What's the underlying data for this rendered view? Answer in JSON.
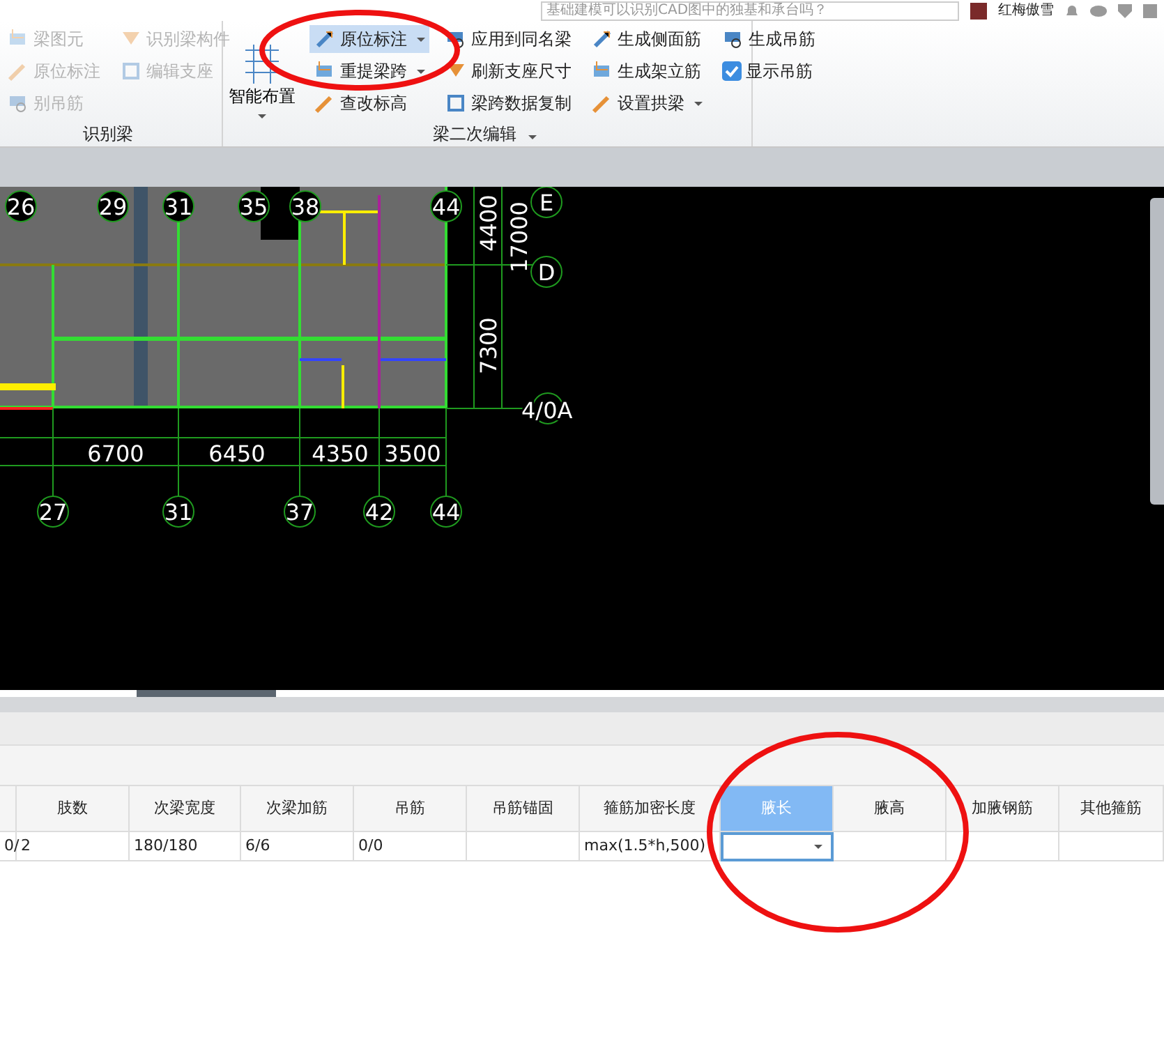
{
  "top_bar": {
    "search": {
      "value": "基础建模可以识别CAD图中的独基和承台吗？"
    },
    "user": {
      "name": "红梅傲雪"
    }
  },
  "ribbon": {
    "groups": [
      {
        "title": "识别梁",
        "title_dropdown": false,
        "columns": [
          [
            {
              "kind": "button",
              "label": "梁图元",
              "disabled": true,
              "selected": false,
              "dropdown": false
            },
            {
              "kind": "button",
              "label": "原位标注",
              "disabled": true,
              "selected": false,
              "dropdown": false
            },
            {
              "kind": "button",
              "label": "别吊筋",
              "disabled": true,
              "selected": false,
              "dropdown": false
            }
          ],
          [
            {
              "kind": "button",
              "label": "识别梁构件",
              "disabled": true,
              "selected": false,
              "dropdown": false
            },
            {
              "kind": "button",
              "label": "编辑支座",
              "disabled": true,
              "selected": false,
              "dropdown": false
            }
          ]
        ]
      },
      {
        "title": "梁二次编辑",
        "title_dropdown": true,
        "large": {
          "label": "智能布置",
          "dropdown": true
        },
        "columns": [
          [
            {
              "kind": "button",
              "label": "原位标注",
              "disabled": false,
              "selected": true,
              "dropdown": true
            },
            {
              "kind": "button",
              "label": "重提梁跨",
              "disabled": false,
              "selected": false,
              "dropdown": true
            },
            {
              "kind": "button",
              "label": "查改标高",
              "disabled": false,
              "selected": false,
              "dropdown": false
            }
          ],
          [
            {
              "kind": "button",
              "label": "应用到同名梁",
              "disabled": false,
              "selected": false,
              "dropdown": false
            },
            {
              "kind": "button",
              "label": "刷新支座尺寸",
              "disabled": false,
              "selected": false,
              "dropdown": false
            },
            {
              "kind": "button",
              "label": "梁跨数据复制",
              "disabled": false,
              "selected": false,
              "dropdown": false
            }
          ],
          [
            {
              "kind": "button",
              "label": "生成侧面筋",
              "disabled": false,
              "selected": false,
              "dropdown": false
            },
            {
              "kind": "button",
              "label": "生成架立筋",
              "disabled": false,
              "selected": false,
              "dropdown": false
            },
            {
              "kind": "button",
              "label": "设置拱梁",
              "disabled": false,
              "selected": false,
              "dropdown": true
            }
          ],
          [
            {
              "kind": "button",
              "label": "生成吊筋",
              "disabled": false,
              "selected": false,
              "dropdown": false
            },
            {
              "kind": "checkbox",
              "label": "显示吊筋",
              "checked": true,
              "disabled": false,
              "selected": false,
              "dropdown": false
            }
          ]
        ]
      }
    ]
  },
  "cad": {
    "top_axes": [
      "26",
      "29",
      "31",
      "35",
      "38",
      "44"
    ],
    "row_axes": [
      "E",
      "D",
      "4/0A"
    ],
    "vertical_dimensions": [
      "4400",
      "17000",
      "7300"
    ],
    "horizontal_dimensions": [
      "6700",
      "6450",
      "4350",
      "3500"
    ],
    "bottom_axes": [
      "27",
      "31",
      "37",
      "42",
      "44"
    ]
  },
  "table": {
    "columns": [
      {
        "selected": false
      },
      {
        "label": "肢数",
        "selected": false
      },
      {
        "label": "次梁宽度",
        "selected": false
      },
      {
        "label": "次梁加筋",
        "selected": false
      },
      {
        "label": "吊筋",
        "selected": false
      },
      {
        "label": "吊筋锚固",
        "selected": false
      },
      {
        "label": "箍筋加密长度",
        "selected": false
      },
      {
        "label": "腋长",
        "selected": true
      },
      {
        "label": "腋高",
        "selected": false
      },
      {
        "label": "加腋钢筋",
        "selected": false
      },
      {
        "label": "其他箍筋",
        "selected": false
      }
    ],
    "rows": [
      {
        "cells": [
          {
            "kind": "text",
            "text": "0/"
          },
          {
            "kind": "text",
            "text": "2"
          },
          {
            "kind": "text",
            "text": "180/180"
          },
          {
            "kind": "text",
            "text": "6/6"
          },
          {
            "kind": "text",
            "text": "0/0"
          },
          {
            "kind": "empty"
          },
          {
            "kind": "text",
            "text": "max(1.5*h,500)"
          },
          {
            "kind": "dropdown"
          },
          {
            "kind": "empty"
          },
          {
            "kind": "empty"
          },
          {
            "kind": "empty"
          }
        ]
      }
    ]
  },
  "annotations": [
    {
      "kind": "ellipse"
    },
    {
      "kind": "ellipse"
    }
  ]
}
